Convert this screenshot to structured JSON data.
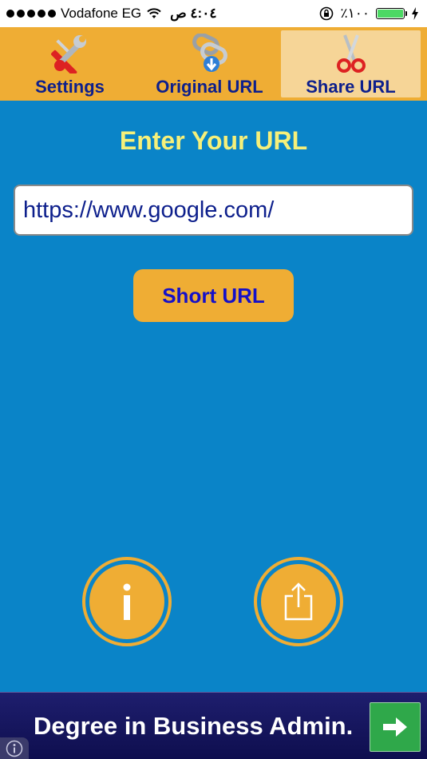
{
  "status_bar": {
    "carrier": "Vodafone EG",
    "time": "٤:٠٤ ص",
    "battery_text": "٪١٠٠",
    "battery_level": 1.0
  },
  "tabs": [
    {
      "label": "Settings",
      "icon": "tools-icon",
      "active": false
    },
    {
      "label": "Original URL",
      "icon": "chain-link-icon",
      "active": false
    },
    {
      "label": "Share URL",
      "icon": "scissors-icon",
      "active": true
    }
  ],
  "main": {
    "heading": "Enter Your URL",
    "url_value": "https://www.google.com/",
    "short_button_label": "Short URL"
  },
  "bottom_actions": {
    "info_icon": "info-icon",
    "share_icon": "share-icon"
  },
  "ad": {
    "text": "Degree in Business Admin.",
    "arrow_icon": "arrow-right-icon",
    "info_icon": "ad-info-icon"
  },
  "colors": {
    "background": "#0a84c8",
    "accent": "#efad34",
    "heading": "#f6f07a",
    "tab_label": "#0d1f8c"
  }
}
